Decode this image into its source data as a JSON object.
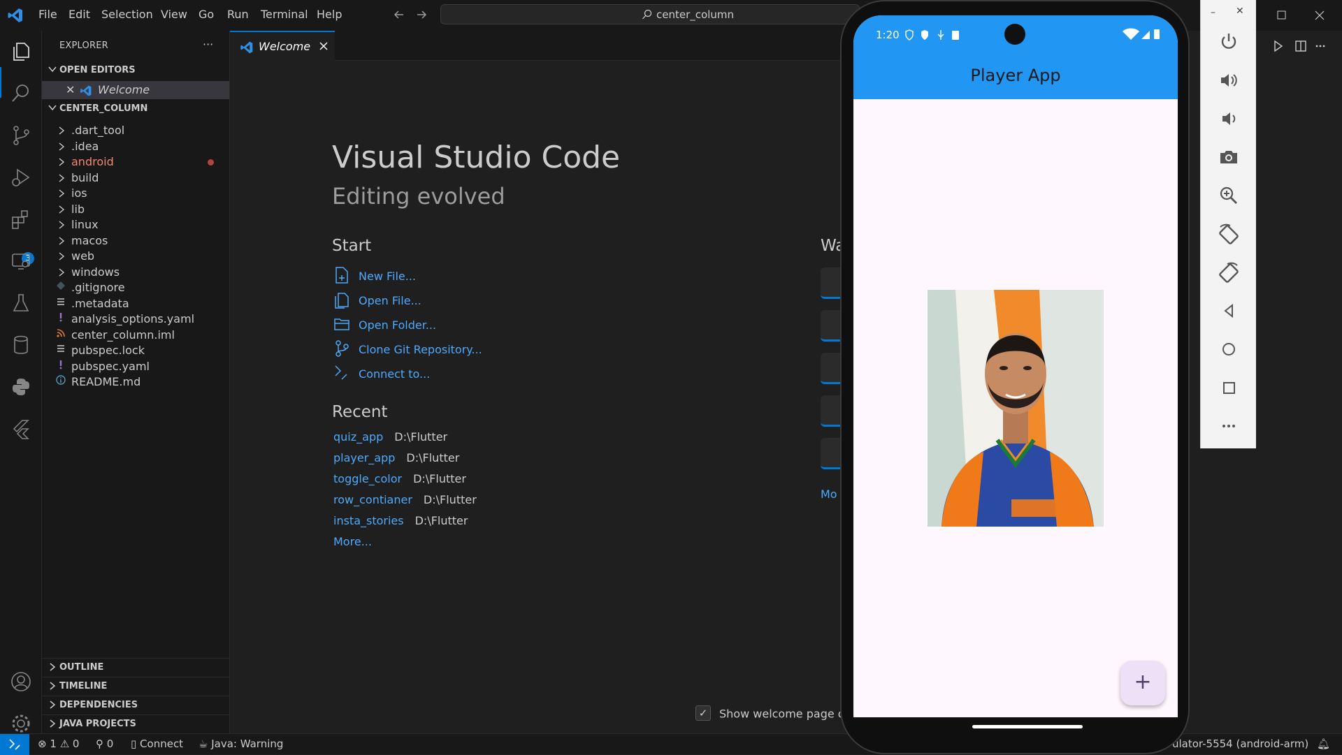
{
  "menu": [
    "File",
    "Edit",
    "Selection",
    "View",
    "Go",
    "Run",
    "Terminal",
    "Help"
  ],
  "command_center": "center_column",
  "activity_badge": "3",
  "explorer": {
    "title": "EXPLORER",
    "open_editors_title": "OPEN EDITORS",
    "open_editor_item": "Welcome",
    "project_title": "CENTER_COLUMN",
    "items": [
      {
        "label": ".dart_tool",
        "kind": "folder"
      },
      {
        "label": ".idea",
        "kind": "folder"
      },
      {
        "label": "android",
        "kind": "folder",
        "color": "#f48771"
      },
      {
        "label": "build",
        "kind": "folder"
      },
      {
        "label": "ios",
        "kind": "folder"
      },
      {
        "label": "lib",
        "kind": "folder"
      },
      {
        "label": "linux",
        "kind": "folder"
      },
      {
        "label": "macos",
        "kind": "folder"
      },
      {
        "label": "web",
        "kind": "folder"
      },
      {
        "label": "windows",
        "kind": "folder"
      },
      {
        "label": ".gitignore",
        "kind": "file",
        "icon": "git-icon"
      },
      {
        "label": ".metadata",
        "kind": "file",
        "icon": "lines-icon"
      },
      {
        "label": "analysis_options.yaml",
        "kind": "file",
        "icon": "yaml-icon"
      },
      {
        "label": "center_column.iml",
        "kind": "file",
        "icon": "rss-icon"
      },
      {
        "label": "pubspec.lock",
        "kind": "file",
        "icon": "lines-icon"
      },
      {
        "label": "pubspec.yaml",
        "kind": "file",
        "icon": "yaml-icon"
      },
      {
        "label": "README.md",
        "kind": "file",
        "icon": "info-icon"
      }
    ]
  },
  "bottom_sections": [
    "OUTLINE",
    "TIMELINE",
    "DEPENDENCIES",
    "JAVA PROJECTS"
  ],
  "tab": {
    "label": "Welcome"
  },
  "welcome": {
    "title": "Visual Studio Code",
    "subtitle": "Editing evolved",
    "start_heading": "Start",
    "start_items": [
      "New File...",
      "Open File...",
      "Open Folder...",
      "Clone Git Repository...",
      "Connect to..."
    ],
    "recent_heading": "Recent",
    "recent": [
      {
        "name": "quiz_app",
        "path": "D:\\Flutter"
      },
      {
        "name": "player_app",
        "path": "D:\\Flutter"
      },
      {
        "name": "toggle_color",
        "path": "D:\\Flutter"
      },
      {
        "name": "row_contianer",
        "path": "D:\\Flutter"
      },
      {
        "name": "insta_stories",
        "path": "D:\\Flutter"
      }
    ],
    "recent_more": "More...",
    "walkthroughs_heading_partial": "Wa",
    "walkthroughs_more_partial": "Mo",
    "show_welcome": "Show welcome page on"
  },
  "statusbar": {
    "errors": "1",
    "warnings": "0",
    "ports": "0",
    "connect": "Connect",
    "java": "Java: Warning",
    "device": "ulator-5554 (android-arm)"
  },
  "phone": {
    "time": "1:20",
    "app_title": "Player App",
    "fab_label": "+"
  },
  "colors": {
    "accent": "#0078d4",
    "appbar": "#2196f3",
    "link": "#4daafc"
  }
}
